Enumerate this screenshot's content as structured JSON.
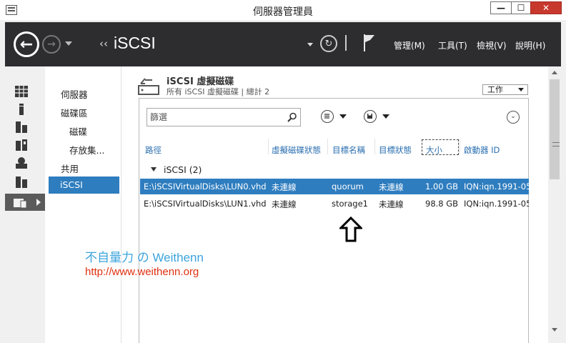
{
  "window": {
    "title": "伺服器管理員",
    "min_glyph": "—",
    "max_glyph": "☐",
    "close_glyph": "✕"
  },
  "header": {
    "back_glyph": "←",
    "forward_glyph": "→",
    "breadcrumb_sep": "‹‹",
    "breadcrumb": "iSCSI",
    "refresh_glyph": "↻",
    "menus": [
      "管理(M)",
      "工具(T)",
      "檢視(V)",
      "說明(H)"
    ]
  },
  "nav": {
    "items": [
      "伺服器",
      "磁碟區",
      "磁碟",
      "存放集...",
      "共用",
      "iSCSI"
    ]
  },
  "tile": {
    "title": "iSCSI 虛擬磁碟",
    "subtitle": "所有 iSCSI 虛擬磁碟 | 總計 2",
    "tasks_label": "工作",
    "filter_placeholder": "篩選",
    "expander_glyph": "⌄"
  },
  "table": {
    "columns": [
      "路徑",
      "虛擬磁碟狀態",
      "目標名稱",
      "目標狀態",
      "大小",
      "啟動器 ID"
    ],
    "group_label": "iSCSI (2)",
    "rows": [
      {
        "path": "E:\\iSCSIVirtualDisks\\LUN0.vhd",
        "disk_status": "未連線",
        "target": "quorum",
        "target_status": "未連線",
        "size": "1.00 GB",
        "initiator": "IQN:iqn.1991-05"
      },
      {
        "path": "E:\\iSCSIVirtualDisks\\LUN1.vhd",
        "disk_status": "未連線",
        "target": "storage1",
        "target_status": "未連線",
        "size": "98.8 GB",
        "initiator": "IQN:iqn.1991-05"
      }
    ]
  },
  "watermark": {
    "line1": "不自量力 の Weithenn",
    "line2": "http://www.weithenn.org"
  },
  "icons": {
    "app": "server-manager-icon",
    "arrow": "up-arrow-annotation-icon"
  },
  "colors": {
    "header_bg": "#2d2d30",
    "selection": "#2e7dbf",
    "column_header": "#2a6fb0",
    "close_button": "#c7382d",
    "watermark_blue": "#3ba4dd",
    "watermark_red": "#e03010"
  }
}
